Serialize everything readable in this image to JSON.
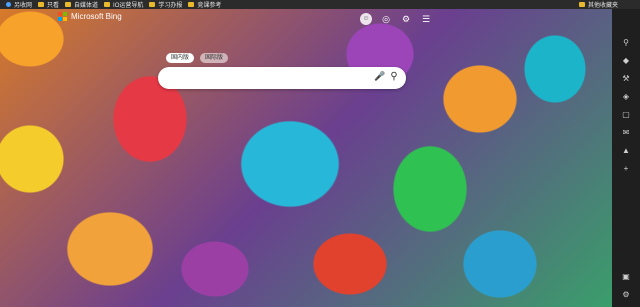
{
  "bookmarks": {
    "items": [
      {
        "label": "另收网",
        "icon": "globe-icon"
      },
      {
        "label": "只看",
        "icon": "folder-icon"
      },
      {
        "label": "自媒体道",
        "icon": "folder-icon"
      },
      {
        "label": "IO运营导航",
        "icon": "folder-icon"
      },
      {
        "label": "学习办报",
        "icon": "folder-icon"
      },
      {
        "label": "竞课参考",
        "icon": "folder-icon"
      }
    ],
    "right_label": "其他收藏夹"
  },
  "header": {
    "logo_text": "Microsoft Bing",
    "icons": [
      "user-icon",
      "rewards-icon",
      "settings-icon",
      "menu-icon"
    ]
  },
  "tabs": [
    {
      "label": "国内版",
      "active": true
    },
    {
      "label": "国际版",
      "active": false
    }
  ],
  "search": {
    "value": "",
    "placeholder": ""
  },
  "sidebar": {
    "icons": [
      "search-icon",
      "shopping-icon",
      "tools-icon",
      "games-icon",
      "office-icon",
      "outlook-icon",
      "drop-icon",
      "add-icon"
    ],
    "bottom_icons": [
      "layout-icon",
      "settings-icon"
    ]
  },
  "colors": {
    "accent": "#1a73e8",
    "folder": "#e8b92c",
    "bar": "#2b2b2b"
  }
}
